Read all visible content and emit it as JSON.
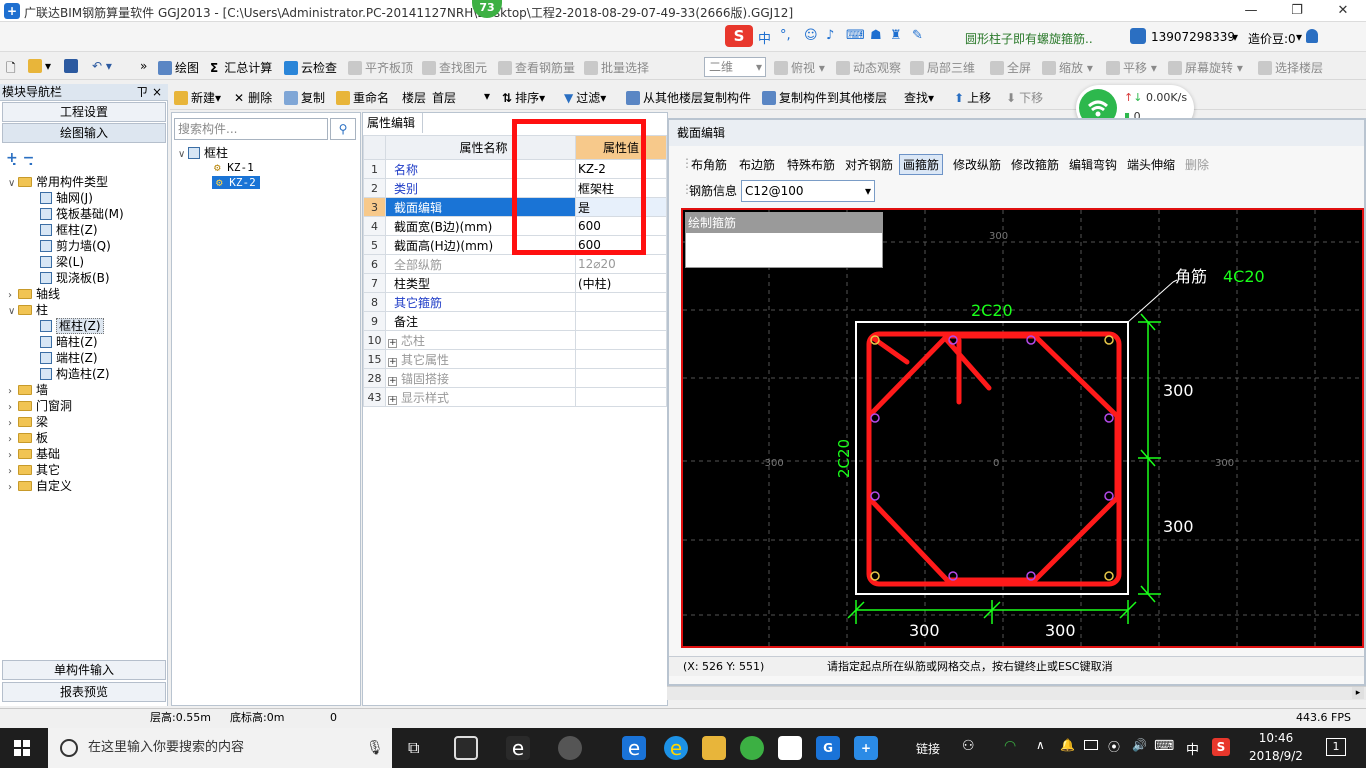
{
  "window": {
    "title": "广联达BIM钢筋算量软件 GGJ2013 - [C:\\Users\\Administrator.PC-20141127NRH\\Desktop\\工程2-2018-08-29-07-49-33(2666版).GGJ12]",
    "badge": "73"
  },
  "topbar": {
    "ime_logo": "S",
    "ime_lang": "中",
    "tip_text": "圆形柱子即有螺旋箍筋..",
    "phone": "13907298339",
    "price_label": "造价豆:0"
  },
  "toolbar1": {
    "draw": "绘图",
    "sum": "汇总计算",
    "cloud_check": "云检查",
    "flat_top": "平齐板顶",
    "find_elem": "查找图元",
    "view_rebar": "查看钢筋量",
    "batch_select": "批量选择",
    "view_mode": "二维",
    "top_view": "俯视",
    "dynamic": "动态观察",
    "local3d": "局部三维",
    "fullscreen": "全屏",
    "zoom": "缩放",
    "pan": "平移",
    "rotate": "屏幕旋转",
    "select_floor": "选择楼层"
  },
  "toolbar2": {
    "new": "新建",
    "delete": "删除",
    "copy": "复制",
    "rename": "重命名",
    "floor_label": "楼层",
    "floor_value": "首层",
    "sort": "排序",
    "filter": "过滤",
    "copy_from": "从其他楼层复制构件",
    "copy_to": "复制构件到其他楼层",
    "find": "查找",
    "up": "上移",
    "down": "下移"
  },
  "leftpanel": {
    "header": "模块导航栏",
    "pin": "ㄗ ×",
    "btn_project": "工程设置",
    "btn_draw": "绘图输入",
    "btn_single": "单构件输入",
    "btn_report": "报表预览",
    "tree": [
      {
        "label": "常用构件类型",
        "level": 0,
        "folder": true,
        "expanded": true
      },
      {
        "label": "轴网(J)",
        "level": 1
      },
      {
        "label": "筏板基础(M)",
        "level": 1
      },
      {
        "label": "框柱(Z)",
        "level": 1
      },
      {
        "label": "剪力墙(Q)",
        "level": 1
      },
      {
        "label": "梁(L)",
        "level": 1
      },
      {
        "label": "现浇板(B)",
        "level": 1
      },
      {
        "label": "轴线",
        "level": 0,
        "folder": true
      },
      {
        "label": "柱",
        "level": 0,
        "folder": true,
        "expanded": true
      },
      {
        "label": "框柱(Z)",
        "level": 1,
        "selected": true
      },
      {
        "label": "暗柱(Z)",
        "level": 1
      },
      {
        "label": "端柱(Z)",
        "level": 1
      },
      {
        "label": "构造柱(Z)",
        "level": 1
      },
      {
        "label": "墙",
        "level": 0,
        "folder": true
      },
      {
        "label": "门窗洞",
        "level": 0,
        "folder": true
      },
      {
        "label": "梁",
        "level": 0,
        "folder": true
      },
      {
        "label": "板",
        "level": 0,
        "folder": true
      },
      {
        "label": "基础",
        "level": 0,
        "folder": true
      },
      {
        "label": "其它",
        "level": 0,
        "folder": true
      },
      {
        "label": "自定义",
        "level": 0,
        "folder": true
      }
    ]
  },
  "midpanel": {
    "search_placeholder": "搜索构件...",
    "root": "框柱",
    "items": [
      "KZ-1",
      "KZ-2"
    ]
  },
  "props": {
    "tab": "属性编辑",
    "col_name": "属性名称",
    "col_value": "属性值",
    "rows": [
      {
        "n": "1",
        "k": "名称",
        "v": "KZ-2",
        "style": "blue"
      },
      {
        "n": "2",
        "k": "类别",
        "v": "框架柱",
        "style": "blue"
      },
      {
        "n": "3",
        "k": "截面编辑",
        "v": "是",
        "style": "sel"
      },
      {
        "n": "4",
        "k": "截面宽(B边)(mm)",
        "v": "600",
        "style": ""
      },
      {
        "n": "5",
        "k": "截面高(H边)(mm)",
        "v": "600",
        "style": ""
      },
      {
        "n": "6",
        "k": "全部纵筋",
        "v": "12⌀20",
        "style": "gray"
      },
      {
        "n": "7",
        "k": "柱类型",
        "v": "(中柱)",
        "style": ""
      },
      {
        "n": "8",
        "k": "其它箍筋",
        "v": "",
        "style": "blue"
      },
      {
        "n": "9",
        "k": "备注",
        "v": "",
        "style": ""
      },
      {
        "n": "10",
        "k": "芯柱",
        "v": "",
        "style": "plus"
      },
      {
        "n": "15",
        "k": "其它属性",
        "v": "",
        "style": "plus"
      },
      {
        "n": "28",
        "k": "锚固搭接",
        "v": "",
        "style": "plus"
      },
      {
        "n": "43",
        "k": "显示样式",
        "v": "",
        "style": "plus"
      }
    ]
  },
  "section": {
    "title": "截面编辑",
    "tools": [
      "布角筋",
      "布边筋",
      "特殊布筋",
      "对齐钢筋",
      "画箍筋",
      "修改纵筋",
      "修改箍筋",
      "编辑弯钩",
      "端头伸缩",
      "删除"
    ],
    "rebar_info_label": "钢筋信息",
    "rebar_info_value": "C12@100",
    "popup": "绘制箍筋",
    "corner_label": "角筋",
    "corner_value": "4C20",
    "top_label": "2C20",
    "left_label": "2C20",
    "dim_right_top": "300",
    "dim_right_bottom": "300",
    "dim_bottom_left": "300",
    "dim_bottom_right": "300",
    "grid_top": "300",
    "grid_left": "-300",
    "grid_right": "300",
    "grid_center": "0",
    "coords": "(X: 526 Y: 551)",
    "hint": "请指定起点所在纵筋或网格交点，按右键终止或ESC键取消"
  },
  "network": {
    "speed": "0.00K/s",
    "count": "0"
  },
  "statusbar": {
    "floor_height": "层高:0.55m",
    "base_height": "底标高:0m",
    "value": "0",
    "fps": "443.6 FPS"
  },
  "taskbar": {
    "search_placeholder": "在这里输入你要搜索的内容",
    "link": "链接",
    "lang": "中",
    "time": "10:46",
    "date": "2018/9/2",
    "notif": "1"
  },
  "colors": {
    "rebar": "#ff1a1a",
    "dimension": "#1aff1a",
    "selection": "#1a74d6"
  }
}
